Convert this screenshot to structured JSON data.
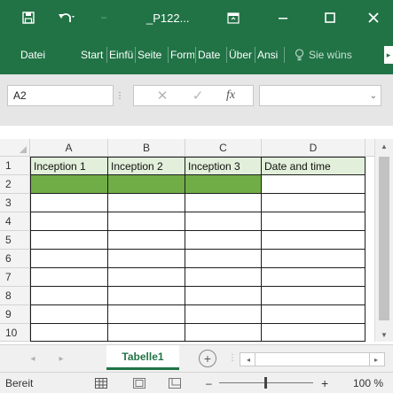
{
  "window": {
    "title": "_P122...",
    "colors": {
      "brand": "#217346",
      "header_fill": "#e2efda",
      "selection_fill": "#70ad47"
    },
    "icons": [
      "save-icon",
      "undo-icon",
      "redo-icon",
      "ribbon-display-icon",
      "minimize-icon",
      "maximize-icon",
      "close-icon"
    ]
  },
  "ribbon": {
    "tabs": [
      "Datei",
      "Start",
      "Einfü",
      "Seite",
      "Form",
      "Date",
      "Über",
      "Ansi"
    ],
    "tell_me": "Sie wüns"
  },
  "formula_bar": {
    "name_box": "A2",
    "fx_label": "fx",
    "value": ""
  },
  "sheet": {
    "columns": [
      "A",
      "B",
      "C",
      "D"
    ],
    "rows": [
      "1",
      "2",
      "3",
      "4",
      "5",
      "6",
      "7",
      "8",
      "9",
      "10"
    ],
    "header_cells": [
      "Inception 1",
      "Inception 2",
      "Inception 3",
      "Date and time"
    ],
    "selected_cell": "A2"
  },
  "tabs_bar": {
    "sheet_tab": "Tabelle1",
    "add_sheet": "+"
  },
  "status": {
    "ready": "Bereit",
    "zoom": "100 %",
    "zoom_minus": "–",
    "zoom_plus": "+"
  }
}
